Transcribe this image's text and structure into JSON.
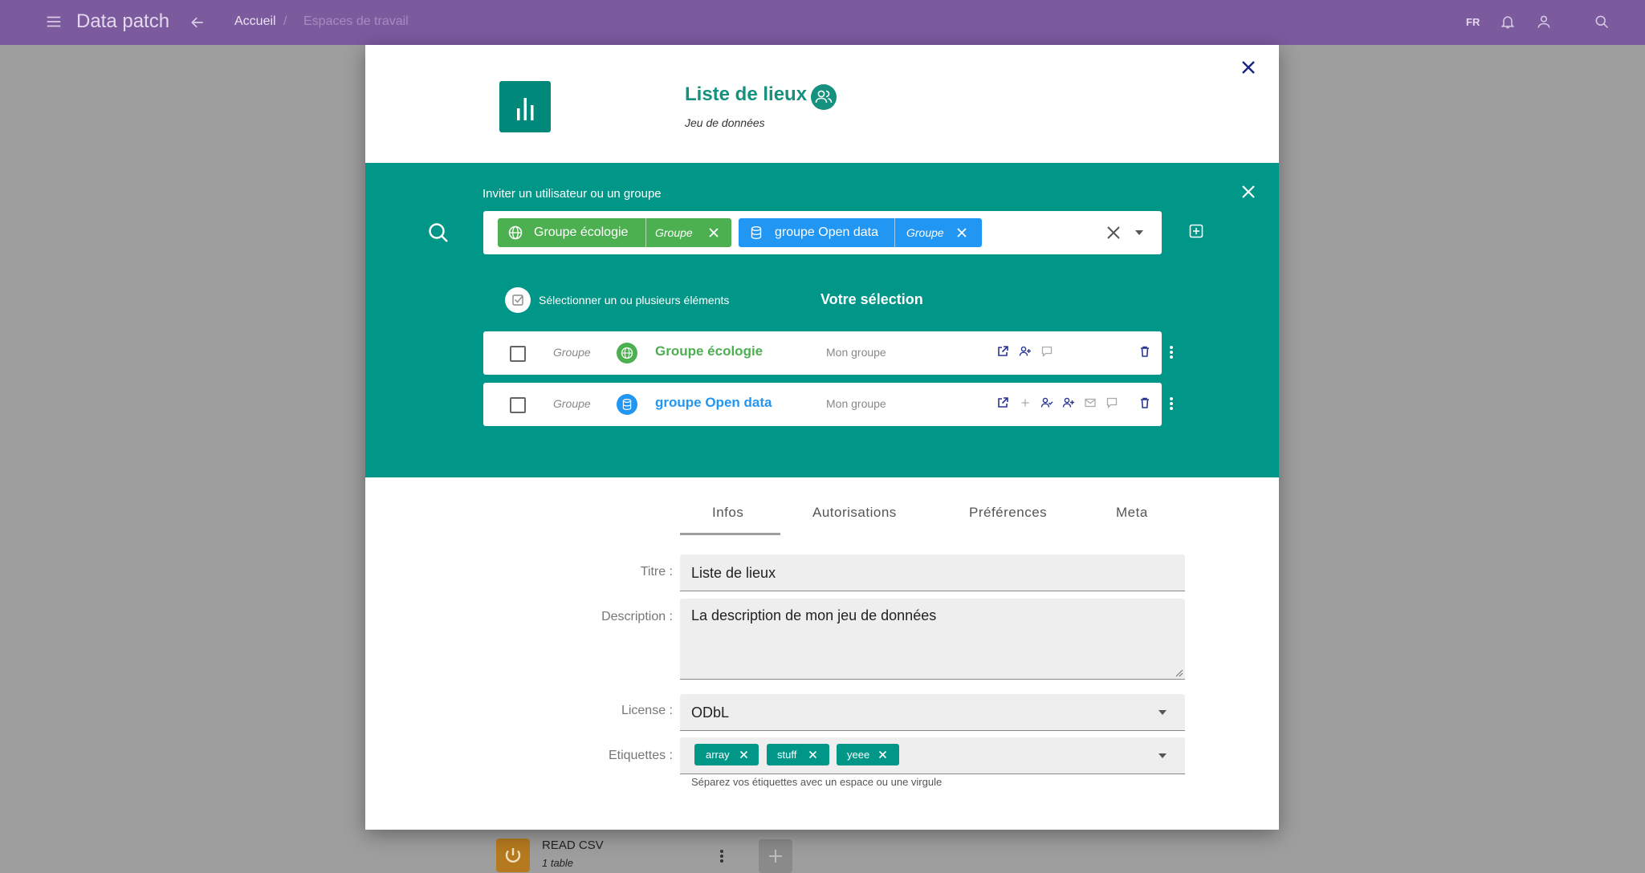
{
  "app": {
    "title": "Data patch",
    "lang": "FR"
  },
  "breadcrumb": {
    "home": "Accueil",
    "separator": "/",
    "current": "Espaces de travail"
  },
  "background_item": {
    "name": "READ CSV",
    "subtitle": "1 table"
  },
  "dataset": {
    "title": "Liste de lieux",
    "type": "Jeu de données"
  },
  "invite": {
    "label": "Inviter un utilisateur ou un groupe",
    "chips": [
      {
        "name": "Groupe écologie",
        "type": "Groupe",
        "color": "#4caf50"
      },
      {
        "name": "groupe Open data",
        "type": "Groupe",
        "color": "#2196f3"
      }
    ],
    "select_label": "Sélectionner un ou plusieurs éléments",
    "selection_title": "Votre sélection",
    "rows": [
      {
        "type": "Groupe",
        "name": "Groupe écologie",
        "group": "Mon groupe",
        "color": "#4caf50"
      },
      {
        "type": "Groupe",
        "name": "groupe Open data",
        "group": "Mon groupe",
        "color": "#2196f3"
      }
    ]
  },
  "tabs": [
    "Infos",
    "Autorisations",
    "Préférences",
    "Meta"
  ],
  "form": {
    "title_label": "Titre :",
    "title_value": "Liste de lieux",
    "description_label": "Description :",
    "description_value": "La description de mon jeu de données",
    "license_label": "License :",
    "license_value": "ODbL",
    "tags_label": "Etiquettes :",
    "tags": [
      "array",
      "stuff",
      "yeee"
    ],
    "tags_hint": "Séparez vos étiquettes avec un espace ou une virgule"
  },
  "colors": {
    "topbar": "#7b5a9e",
    "teal": "#009688",
    "brand_text": "#16907f"
  }
}
